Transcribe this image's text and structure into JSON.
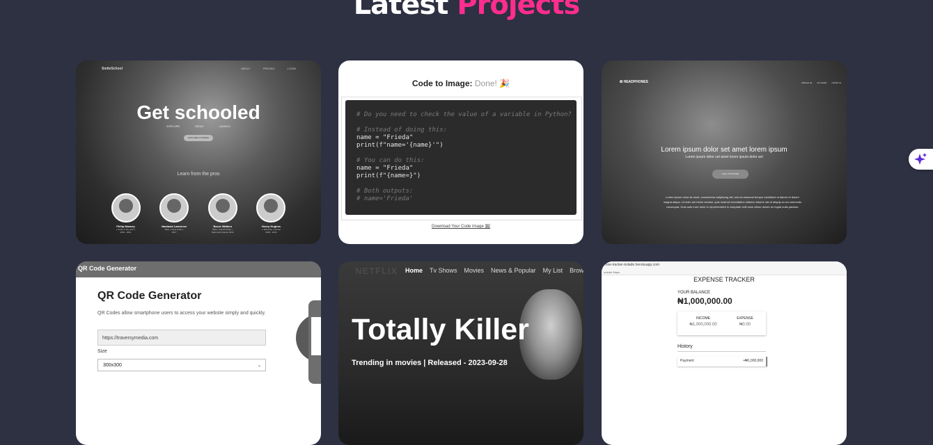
{
  "section": {
    "title_main": "Latest",
    "title_accent": "Projects"
  },
  "colors": {
    "background": "#2d3142",
    "accent": "#ff2d8e"
  },
  "projects": [
    {
      "name": "SmileSchool",
      "logo": "SmileSchool",
      "nav": [
        "ABOUT",
        "PRICING",
        "LOGIN"
      ],
      "headline": "Get schooled",
      "links": [
        "EXPLORE",
        "IDEAS",
        "LAUNCH"
      ],
      "button": "EXPLORE COURSES",
      "sub": "Learn from the pros",
      "people": [
        {
          "name": "Philip Massey",
          "quote": "« Smile of the year »",
          "years": "2019 - 2021"
        },
        {
          "name": "Nastasia Lawrence",
          "quote": "Best « Glow smile »",
          "years": "2017"
        },
        {
          "name": "Bruce Walters",
          "quote": "Best « Friend Smile »",
          "years": "Best performance 2019"
        },
        {
          "name": "Henry Hughes",
          "quote": "« Jeff smile » winner",
          "years": "2018 - 2019"
        }
      ]
    },
    {
      "name": "Code to Image",
      "title": "Code to Image:",
      "status": "Done! 🎉",
      "code_lines": [
        {
          "text": "# Do you need to check the value of a variable in Python?",
          "comment": true
        },
        {
          "text": "",
          "comment": false
        },
        {
          "text": "# Instead of doing this:",
          "comment": true
        },
        {
          "text": "name = \"Frieda\"",
          "comment": false
        },
        {
          "text": "print(f\"name='{name}'\")",
          "comment": false
        },
        {
          "text": "",
          "comment": false
        },
        {
          "text": "# You can do this:",
          "comment": true
        },
        {
          "text": "name = \"Frieda\"",
          "comment": false
        },
        {
          "text": "print(f\"{name=}\")",
          "comment": false
        },
        {
          "text": "",
          "comment": false
        },
        {
          "text": "# Both outputs:",
          "comment": true
        },
        {
          "text": "# name='Frieda'",
          "comment": true
        }
      ],
      "download": "Download Your Code Image 🖼"
    },
    {
      "name": "Headphones",
      "logo": "HEADPHONES",
      "nav": [
        "what we do",
        "our results",
        "contact us"
      ],
      "headline": "Lorem ipsum dolor set amet lorem ipsum",
      "sub": "Lorem ipsum dolor set amet lorem ipsum dolor set",
      "cta": "CALL TO ACTION",
      "paragraph": "Lorem ipsum dolor sit amet, consectetur adipiscing elit, sed do eiusmod tempor incididunt ut labore et dolore magna aliqua. Ut enim ad minim veniam, quis nostrud exercitation ullamco laboris nisi ut aliquip ex ea commodo consequat. Duis aute irure dolor in reprehenderit in voluptate velit esse cillum dolore eu fugiat nulla pariatur."
    },
    {
      "name": "QR Code Generator",
      "bar_title": "QR Code Generator",
      "heading": "QR Code Generator",
      "description": "QR Codes allow smartphone users to access your website simply and quickly.",
      "url_value": "https://traversymedia.com",
      "size_label": "Size",
      "size_value": "300x300"
    },
    {
      "name": "Netflix clone",
      "brand": "NETFLIX",
      "nav": [
        "Home",
        "Tv Shows",
        "Movies",
        "News & Popular",
        "My List",
        "Browse by"
      ],
      "title": "Totally Killer",
      "trending": "Trending in movies | Released - 2023-09-28"
    },
    {
      "name": "Expense Tracker",
      "url": "ense-tracker-kolade.herokuapp.com",
      "bookmarks": "outube    Maps",
      "title": "EXPENSE TRACKER",
      "balance_label": "YOUR BALANCE",
      "balance_value": "₦1,000,000.00",
      "income_label": "INCOME",
      "income_value": "₦1,000,000.00",
      "expense_label": "EXPENSE",
      "expense_value": "₦0.00",
      "history_label": "History",
      "history_item": "Payment",
      "history_amount": "+₦1,000,000"
    }
  ]
}
